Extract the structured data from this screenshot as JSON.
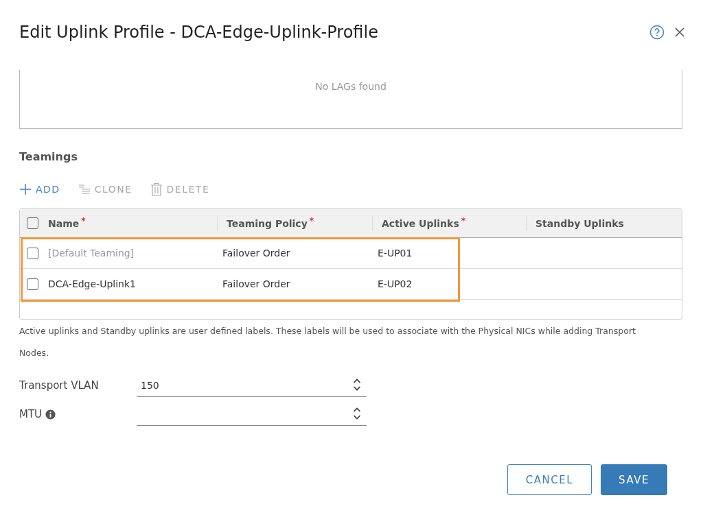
{
  "dialog": {
    "title": "Edit Uplink Profile - DCA-Edge-Uplink-Profile"
  },
  "lags": {
    "empty_text": "No LAGs found"
  },
  "teamings": {
    "heading": "Teamings",
    "toolbar": [
      {
        "kind": "add",
        "label": "ADD",
        "disabled": false
      },
      {
        "kind": "clone",
        "label": "CLONE",
        "disabled": true
      },
      {
        "kind": "delete",
        "label": "DELETE",
        "disabled": true
      }
    ],
    "select_all_checked": false,
    "columns": [
      {
        "label": "Name",
        "required_mark": "*"
      },
      {
        "label": "Teaming Policy",
        "required_mark": "*"
      },
      {
        "label": "Active Uplinks",
        "required_mark": "*"
      },
      {
        "label": "Standby Uplinks"
      }
    ],
    "rows": [
      {
        "checked": false,
        "disabled": true,
        "cells": [
          "[Default Teaming]",
          "Failover Order",
          "E-UP01"
        ]
      },
      {
        "checked": false,
        "disabled": false,
        "cells": [
          "DCA-Edge-Uplink1",
          "Failover Order",
          "E-UP02"
        ]
      }
    ],
    "highlighted": true
  },
  "help_text": "Active uplinks and Standby uplinks are user defined labels. These labels will be used to associate with the Physical NICs while adding Transport Nodes.",
  "fields": [
    {
      "label": "Transport VLAN",
      "value": "150"
    },
    {
      "label": "MTU",
      "info": true
    }
  ],
  "buttons": [
    {
      "kind": "secondary",
      "label": "CANCEL"
    },
    {
      "kind": "primary",
      "label": "SAVE"
    }
  ]
}
